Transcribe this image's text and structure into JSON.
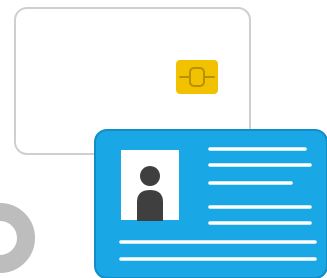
{
  "illustration": {
    "back_card": {
      "icon": "chip-card-icon",
      "fill": "#ffffff",
      "border": "#cfcfcf",
      "chip_color": "#f2c200",
      "chip_line": "#b79200"
    },
    "front_card": {
      "icon": "id-card-icon",
      "fill": "#1aa7e6",
      "border": "#138dc4",
      "photo_bg": "#ffffff",
      "person_color": "#3f3f3f",
      "line_color": "#ffffff"
    },
    "partial_shape": {
      "icon": "partial-gray-ring-icon",
      "color": "#bdbdbd"
    }
  }
}
